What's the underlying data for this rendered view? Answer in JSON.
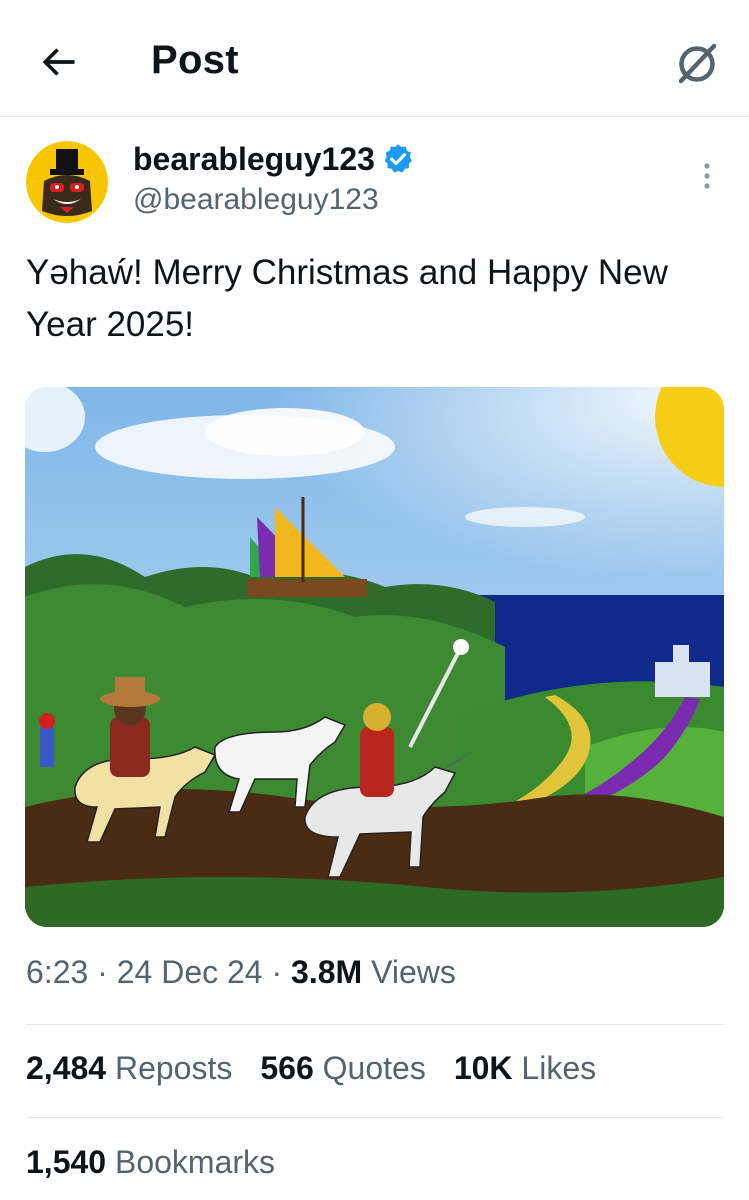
{
  "header": {
    "title": "Post",
    "back_icon": "arrow-left-icon",
    "grok_icon": "grok-icon"
  },
  "tweet": {
    "display_name": "bearableguy123",
    "handle": "@bearableguy123",
    "verified_icon": "verified-badge-icon",
    "more_icon": "more-vertical-icon",
    "text": "Yəhaẃ! Merry Christmas and Happy New Year 2025!"
  },
  "meta": {
    "time": "6:23",
    "sep1": " · ",
    "date": "24 Dec 24",
    "sep2": " · ",
    "views_count": "3.8M",
    "views_label": " Views"
  },
  "stats": {
    "reposts_count": "2,484",
    "reposts_label": " Reposts",
    "quotes_count": "566",
    "quotes_label": " Quotes",
    "likes_count": "10K",
    "likes_label": " Likes",
    "bookmarks_count": "1,540",
    "bookmarks_label": " Bookmarks"
  },
  "colors": {
    "text": "#0f1419",
    "secondary": "#536471",
    "verified": "#1d9bf0",
    "divider": "#e6e9ec"
  }
}
